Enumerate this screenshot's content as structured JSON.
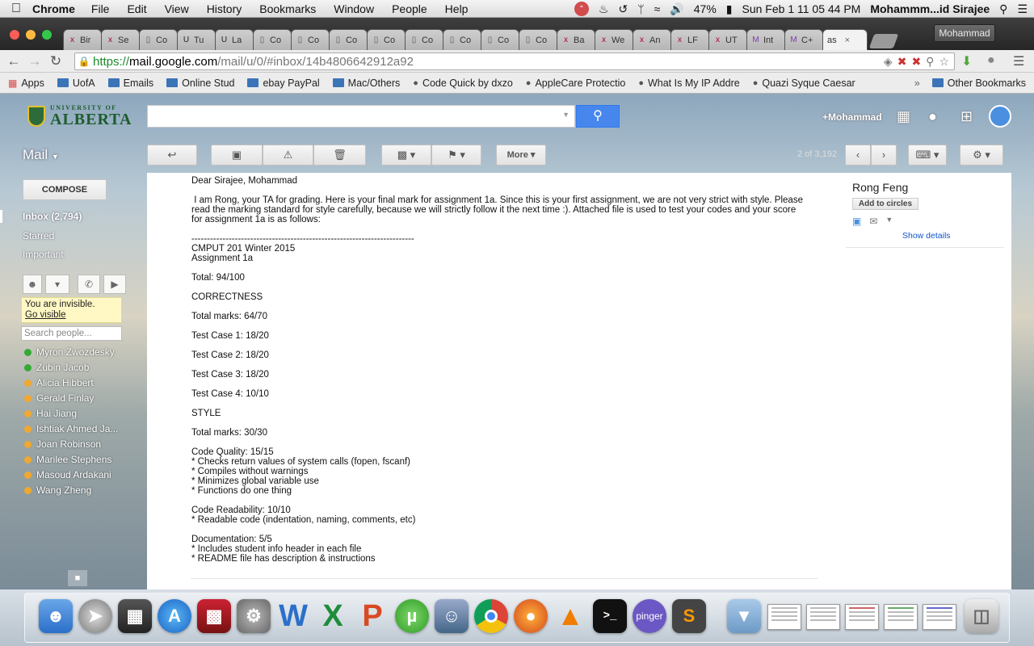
{
  "menubar": {
    "app": "Chrome",
    "items": [
      "File",
      "Edit",
      "View",
      "History",
      "Bookmarks",
      "Window",
      "People",
      "Help"
    ],
    "battery": "47%",
    "datetime": "Sun Feb 1  11 05 44 PM",
    "user": "Mohammm...id Sirajee"
  },
  "tabs": [
    {
      "label": "Bir",
      "icon": "ok-icon"
    },
    {
      "label": "Se",
      "icon": "ok-icon"
    },
    {
      "label": "Co",
      "icon": "doc-icon"
    },
    {
      "label": "Tu",
      "icon": "u-icon"
    },
    {
      "label": "La",
      "icon": "u-icon"
    },
    {
      "label": "Co",
      "icon": "doc-icon"
    },
    {
      "label": "Co",
      "icon": "doc-icon"
    },
    {
      "label": "Co",
      "icon": "doc-icon"
    },
    {
      "label": "Co",
      "icon": "doc-icon"
    },
    {
      "label": "Co",
      "icon": "doc-icon"
    },
    {
      "label": "Co",
      "icon": "doc-icon"
    },
    {
      "label": "Co",
      "icon": "doc-icon"
    },
    {
      "label": "Co",
      "icon": "doc-icon"
    },
    {
      "label": "Ba",
      "icon": "ok-icon"
    },
    {
      "label": "We",
      "icon": "ok-icon"
    },
    {
      "label": "An",
      "icon": "ok-icon"
    },
    {
      "label": "LF",
      "icon": "ok-icon"
    },
    {
      "label": "UT",
      "icon": "ok-icon"
    },
    {
      "label": "Int",
      "icon": "m-icon"
    },
    {
      "label": "C+",
      "icon": "m-icon"
    }
  ],
  "active_tab": {
    "label": "as"
  },
  "profile": "Mohammad",
  "url": {
    "scheme": "https://",
    "host": "mail.google.com",
    "path": "/mail/u/0/#inbox/14b4806642912a92"
  },
  "bookmarks": {
    "apps": "Apps",
    "items": [
      "UofA",
      "Emails",
      "Online Stud",
      "ebay PayPal",
      "Mac/Others",
      "Code Quick by dxzo",
      "AppleCare Protectio",
      "What Is My IP Addre",
      "Quazi Syque Caesar"
    ],
    "overflow": "»",
    "other": "Other Bookmarks"
  },
  "gmail": {
    "logo_small": "UNIVERSITY OF",
    "logo_big": "ALBERTA",
    "user": "+Mohammad",
    "mail_label": "Mail",
    "more_label": "More",
    "page_info": "2 of 3,192",
    "compose": "COMPOSE",
    "nav": [
      "Inbox (2,794)",
      "Starred",
      "Important"
    ],
    "invisible_text": "You are invisible.",
    "go_visible": "Go visible",
    "search_people": "Search people...",
    "contacts": [
      {
        "name": "Myron Zwozdesky",
        "status": "#33aa33"
      },
      {
        "name": "Zubin Jacob",
        "status": "#33aa33"
      },
      {
        "name": "Alicia Hibbert",
        "status": "#f0a830"
      },
      {
        "name": "Gerald Finlay",
        "status": "#f0a830"
      },
      {
        "name": "Hai Jiang",
        "status": "#f0a830"
      },
      {
        "name": "Ishtiak Ahmed Ja...",
        "status": "#f0a830"
      },
      {
        "name": "Joan Robinson",
        "status": "#f0a830"
      },
      {
        "name": "Marilee Stephens",
        "status": "#f0a830"
      },
      {
        "name": "Masoud Ardakani",
        "status": "#f0a830"
      },
      {
        "name": "Wang Zheng",
        "status": "#f0a830"
      }
    ],
    "sender": {
      "name": "Rong Feng",
      "add_circles": "Add to circles",
      "show_details": "Show details"
    },
    "message_lines": [
      "Dear Sirajee, Mohammad",
      "",
      " I am Rong, your TA for grading. Here is your final mark for assignment 1a. Since this is your first assignment, we are not very strict with style. Please",
      "read the marking standard for style carefully, because we will strictly follow it the next time :). Attached file is used to test your codes and your score",
      "for assignment 1a is as follows:",
      "",
      "------------------------------------------------------------------------",
      "CMPUT 201 Winter 2015",
      "Assignment 1a",
      "",
      "Total: 94/100",
      "",
      "CORRECTNESS",
      "",
      "Total marks: 64/70",
      "",
      "Test Case 1: 18/20",
      "",
      "Test Case 2: 18/20",
      "",
      "Test Case 3: 18/20",
      "",
      "Test Case 4: 10/10",
      "",
      "STYLE",
      "",
      "Total marks: 30/30",
      "",
      "Code Quality: 15/15",
      "* Checks return values of system calls (fopen, fscanf)",
      "* Compiles without warnings",
      "* Minimizes global variable use",
      "* Functions do one thing",
      "",
      "Code Readability: 10/10",
      "* Readable code (indentation, naming, comments, etc)",
      "",
      "Documentation: 5/5",
      "* Includes student info header in each file",
      "* README file has description & instructions"
    ]
  },
  "dock": {
    "pinger_label": "pinger"
  }
}
